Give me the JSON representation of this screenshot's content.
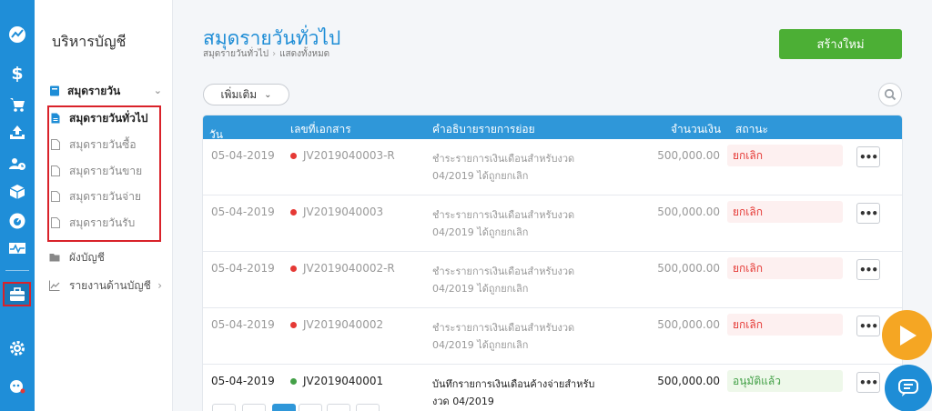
{
  "rail": {
    "icons": [
      "trend-icon",
      "dollar-icon",
      "cart-icon",
      "upload-tray-icon",
      "contacts-icon",
      "box-icon",
      "gauge-icon",
      "pulse-icon",
      "briefcase-icon",
      "gear-icon",
      "support-icon"
    ],
    "active_icon": "briefcase-icon"
  },
  "sidebar": {
    "title": "บริหารบัญชี",
    "group_label": "สมุดรายวัน",
    "sub_items": [
      {
        "label": "สมุดรายวันทั่วไป",
        "active": true
      },
      {
        "label": "สมุดรายวันซื้อ",
        "active": false
      },
      {
        "label": "สมุดรายวันขาย",
        "active": false
      },
      {
        "label": "สมุดรายวันจ่าย",
        "active": false
      },
      {
        "label": "สมุดรายวันรับ",
        "active": false
      }
    ],
    "items": [
      {
        "label": "ผังบัญชี"
      },
      {
        "label": "รายงานด้านบัญชี"
      }
    ]
  },
  "header": {
    "title": "สมุดรายวันทั่วไป",
    "breadcrumb": [
      "สมุดรายวันทั่วไป",
      "แสดงทั้งหมด"
    ],
    "new_button": "สร้างใหม่",
    "more_button": "เพิ่มเติม"
  },
  "table": {
    "columns": {
      "date": "วันที่",
      "doc": "เลขที่เอกสาร",
      "desc": "คำอธิบายรายการย่อย",
      "amount": "จำนวนเงิน",
      "status": "สถานะ"
    },
    "rows": [
      {
        "date": "05-04-2019",
        "doc": "JV2019040003-R",
        "desc1": "ชำระรายการเงินเดือนสำหรับงวด",
        "desc2": "04/2019 ได้ถูกยกเลิก",
        "amount": "500,000.00",
        "status": "ยกเลิก",
        "state": "cancel"
      },
      {
        "date": "05-04-2019",
        "doc": "JV2019040003",
        "desc1": "ชำระรายการเงินเดือนสำหรับงวด",
        "desc2": "04/2019 ได้ถูกยกเลิก",
        "amount": "500,000.00",
        "status": "ยกเลิก",
        "state": "cancel"
      },
      {
        "date": "05-04-2019",
        "doc": "JV2019040002-R",
        "desc1": "ชำระรายการเงินเดือนสำหรับงวด",
        "desc2": "04/2019 ได้ถูกยกเลิก",
        "amount": "500,000.00",
        "status": "ยกเลิก",
        "state": "cancel"
      },
      {
        "date": "05-04-2019",
        "doc": "JV2019040002",
        "desc1": "ชำระรายการเงินเดือนสำหรับงวด",
        "desc2": "04/2019 ได้ถูกยกเลิก",
        "amount": "500,000.00",
        "status": "ยกเลิก",
        "state": "cancel"
      },
      {
        "date": "05-04-2019",
        "doc": "JV2019040001",
        "desc1": "บันทึกรายการเงินเดือนค้างจ่ายสำหรับ",
        "desc2": "งวด 04/2019",
        "amount": "500,000.00",
        "status": "อนุมัติแล้ว",
        "state": "ok"
      }
    ]
  },
  "colors": {
    "brand_blue": "#1e8dd6",
    "table_header": "#2f97d9",
    "new_button": "#4caf35",
    "cancel_red": "#e53935",
    "approved_green": "#43a047",
    "fab_orange": "#f5a623"
  }
}
